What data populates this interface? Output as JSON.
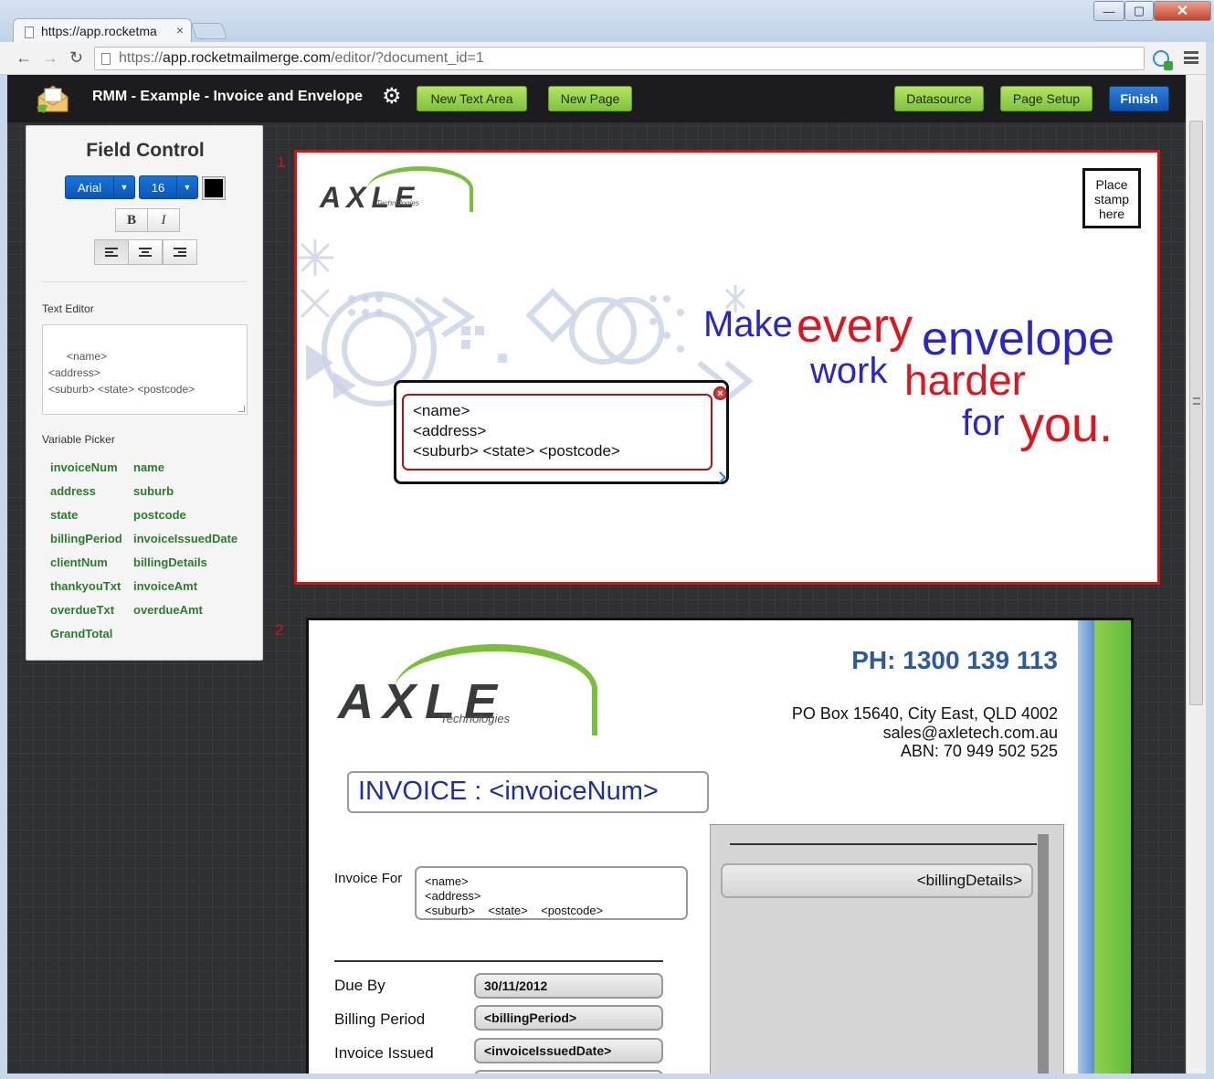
{
  "browser": {
    "tab_title": "https://app.rocketma",
    "tab_close": "×",
    "url_prefix": "https://",
    "url_host": "app.rocketmailmerge.com",
    "url_path": "/editor/?document_id=1",
    "min": "—",
    "max": "▢",
    "close": "✕",
    "back": "←",
    "forward": "→",
    "reload": "↻"
  },
  "app": {
    "doc_title": "RMM - Example - Invoice and Envelope",
    "gear": "⚙",
    "buttons": {
      "new_text_area": "New Text Area",
      "new_page": "New Page",
      "datasource": "Datasource",
      "page_setup": "Page Setup",
      "finish": "Finish"
    }
  },
  "field_control": {
    "title": "Field Control",
    "font": "Arial",
    "size": "16",
    "caret": "▼",
    "bold": "B",
    "italic": "I",
    "text_editor_label": "Text Editor",
    "text_editor_value": "<name>\n<address>\n<suburb> <state> <postcode>",
    "variable_picker_label": "Variable Picker",
    "variables": [
      "invoiceNum",
      "name",
      "address",
      "suburb",
      "state",
      "postcode",
      "billingPeriod",
      "invoiceIssuedDate",
      "clientNum",
      "billingDetails",
      "thankyouTxt",
      "invoiceAmt",
      "overdueTxt",
      "overdueAmt",
      "GrandTotal"
    ]
  },
  "page1": {
    "number": "1",
    "logo_word": "AXLE",
    "logo_sub": "Technologies",
    "stamp": "Place\nstamp\nhere",
    "slogan": {
      "make": "Make",
      "every": "every",
      "envelope": "envelope",
      "work": "work",
      "harder": "harder",
      "for": "for",
      "you": "you."
    },
    "address_text": "<name>\n<address>\n<suburb> <state> <postcode>",
    "close_symbol": "×"
  },
  "page2": {
    "number": "2",
    "logo_word": "AXLE",
    "logo_sub": "Technologies",
    "phone": "PH: 1300 139 113",
    "po_box": "PO Box 15640, City East, QLD 4002",
    "email": "sales@axletech.com.au",
    "abn": "ABN: 70 949 502 525",
    "invoice_title": "INVOICE : <invoiceNum>",
    "invoice_for_label": "Invoice For",
    "invoice_for_text": "<name>\n<address>\n<suburb>    <state>    <postcode>",
    "due_by_label": "Due By",
    "due_by_value": "30/11/2012",
    "billing_period_label": "Billing Period",
    "billing_period_value": "<billingPeriod>",
    "invoice_issued_label": "Invoice Issued",
    "invoice_issued_value": "<invoiceIssuedDate>",
    "billing_details": "<billingDetails>"
  },
  "colors": {
    "accent_green": "#7ec43a",
    "accent_blue": "#0b56b8",
    "page_border_active": "#dc1010",
    "slogan_blue": "#2a25c8",
    "slogan_red": "#e0141c",
    "variable_green": "#2a7d2a"
  }
}
